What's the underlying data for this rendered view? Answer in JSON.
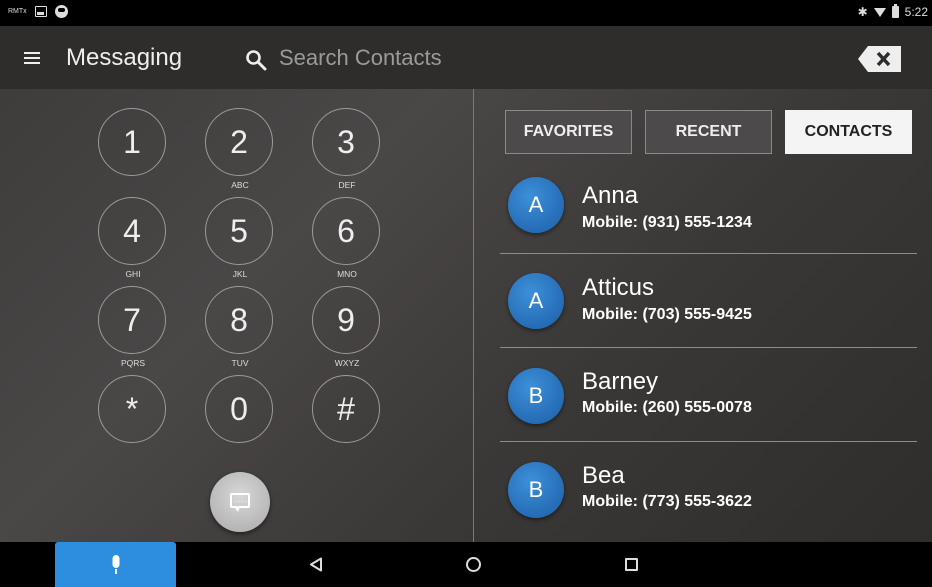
{
  "status_bar": {
    "left_label": "RMTx",
    "time": "5:22",
    "icons": [
      "image-icon",
      "steering-wheel-icon",
      "bluetooth-icon",
      "wifi-icon",
      "battery-icon"
    ]
  },
  "app_bar": {
    "title": "Messaging",
    "search_placeholder": "Search Contacts",
    "icons": [
      "menu-icon",
      "search-icon",
      "backspace-clear-icon"
    ]
  },
  "dialpad": {
    "keys": [
      {
        "digit": "1",
        "letters": ""
      },
      {
        "digit": "2",
        "letters": "ABC"
      },
      {
        "digit": "3",
        "letters": "DEF"
      },
      {
        "digit": "4",
        "letters": "GHI"
      },
      {
        "digit": "5",
        "letters": "JKL"
      },
      {
        "digit": "6",
        "letters": "MNO"
      },
      {
        "digit": "7",
        "letters": "PQRS"
      },
      {
        "digit": "8",
        "letters": "TUV"
      },
      {
        "digit": "9",
        "letters": "WXYZ"
      },
      {
        "digit": "*",
        "letters": ""
      },
      {
        "digit": "0",
        "letters": ""
      },
      {
        "digit": "#",
        "letters": ""
      }
    ],
    "action_icon": "message-icon"
  },
  "tabs": [
    {
      "label": "FAVORITES",
      "active": false
    },
    {
      "label": "RECENT",
      "active": false
    },
    {
      "label": "CONTACTS",
      "active": true
    }
  ],
  "contacts": [
    {
      "initial": "A",
      "name": "Anna",
      "phone": "Mobile:  (931) 555-1234"
    },
    {
      "initial": "A",
      "name": "Atticus",
      "phone": "Mobile:  (703) 555-9425"
    },
    {
      "initial": "B",
      "name": "Barney",
      "phone": "Mobile:  (260) 555-0078"
    },
    {
      "initial": "B",
      "name": "Bea",
      "phone": "Mobile:  (773) 555-3622"
    }
  ],
  "nav_bar": {
    "icons": [
      "microphone-icon",
      "back-icon",
      "home-icon",
      "recents-icon"
    ]
  },
  "colors": {
    "accent_blue": "#2d8ee0",
    "avatar_blue": "#1b5ea6",
    "background": "#3d3b3a",
    "tab_active": "#f4f4f4"
  }
}
